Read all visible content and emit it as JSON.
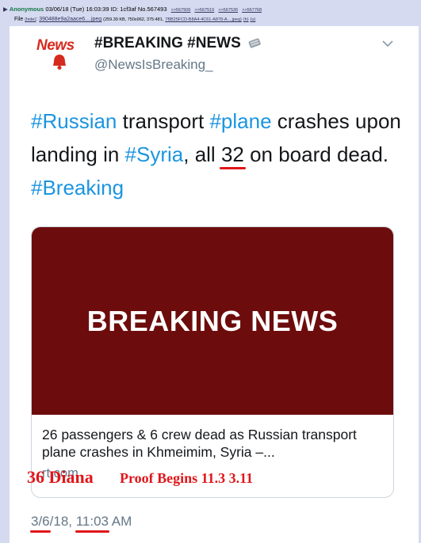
{
  "post": {
    "arrow": "▶",
    "name": "Anonymous",
    "datetime": "03/06/18 (Tue) 16:03:39",
    "id_label": "ID:",
    "id": "1cf3af",
    "number": "No.567493",
    "replies": [
      ">>567506",
      ">>567516",
      ">>567536",
      ">>567768"
    ]
  },
  "file": {
    "label": "File",
    "hide": "(hide)",
    "filename": "390488e9a2aace6....jpeg",
    "meta": "(259.39 KB, 750x962, 375:481,",
    "origname": "7BB25FCD-B8A4-4C61-A878-A....jpeg)",
    "opt_h": "(h)",
    "opt_u": "(u)"
  },
  "tweet": {
    "logo_text": "News",
    "account_name": "#BREAKING #NEWS",
    "handle": "@NewsIsBreaking_",
    "text_parts": {
      "p1": "#Russian",
      "p2": " transport ",
      "p3": "#plane",
      "p4": " crashes upon landing in ",
      "p5": "#Syria",
      "p6": ", all ",
      "p7": "32",
      "p8": " on board dead. ",
      "p9": "#Breaking"
    },
    "card": {
      "image_text": "BREAKING NEWS",
      "title": "26 passengers & 6 crew dead as Russian transport plane crashes in Khmeimim, Syria –...",
      "domain": "rt.com"
    },
    "time_date": "3/6",
    "time_year": "/18, ",
    "time_clock": "11:03",
    "time_ampm": " AM"
  },
  "overlay": {
    "diana": "36 Diana",
    "proof": "Proof Begins 11.3 3.11"
  },
  "colors": {
    "board_bg": "#d6daf0",
    "hashtag": "#1b95e0",
    "card_image": "#6d0c0c",
    "annotation_red": "#e0161a"
  }
}
